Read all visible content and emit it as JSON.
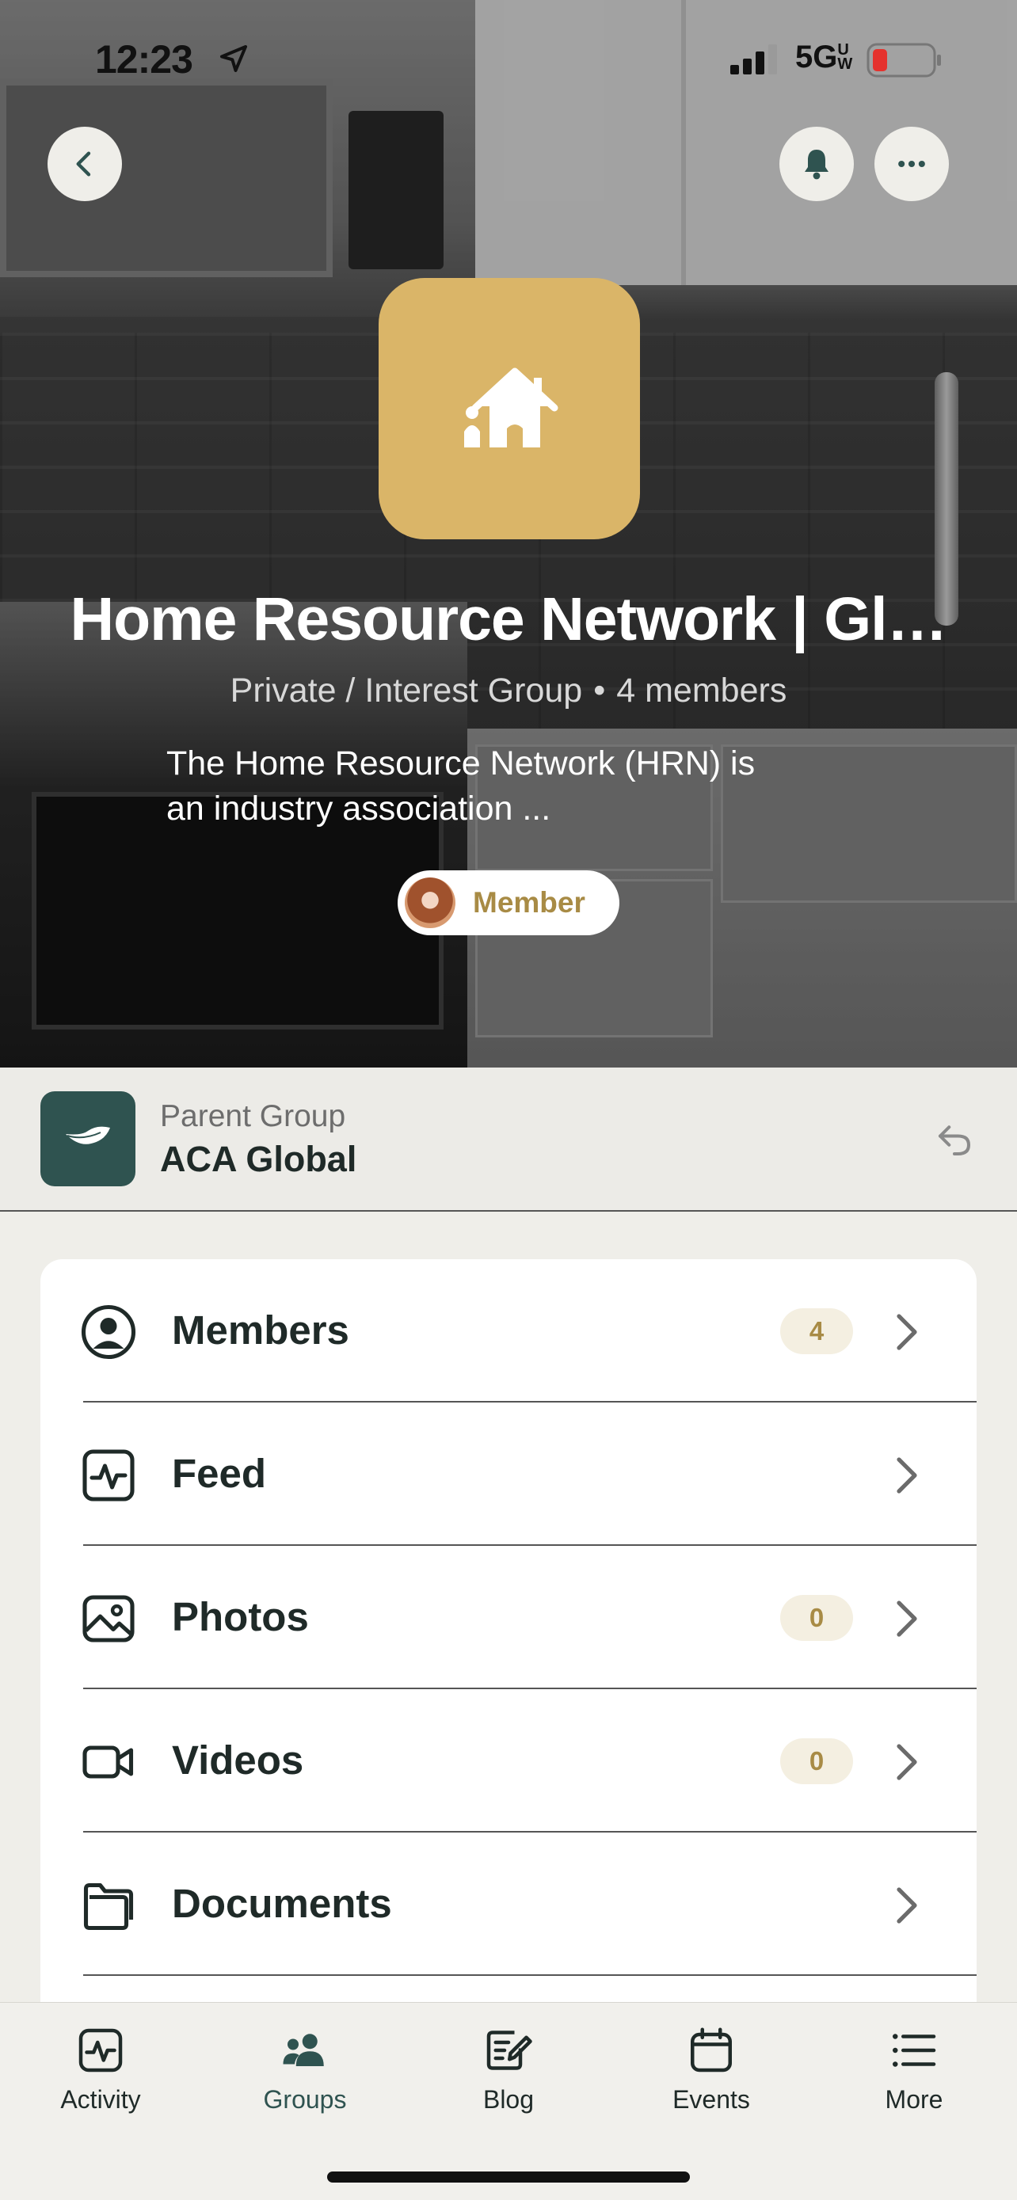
{
  "status_bar": {
    "time": "12:23",
    "network": "5G",
    "network_sub": "UW"
  },
  "header": {
    "back_icon": "chevron-left-icon",
    "bell_icon": "bell-icon",
    "more_icon": "ellipsis-icon"
  },
  "group": {
    "avatar_icon": "house-icon",
    "title": "Home Resource Network | Gl…",
    "privacy": "Private / Interest Group",
    "members_count": "4 members",
    "description_line1": "The Home Resource Network (HRN) is",
    "description_line2": "an industry association ...",
    "membership_label": "Member"
  },
  "parent_group": {
    "caption": "Parent Group",
    "name": "ACA Global"
  },
  "menu": {
    "items": [
      {
        "label": "Members",
        "badge": "4",
        "icon": "user-circle-icon"
      },
      {
        "label": "Feed",
        "badge": "",
        "icon": "activity-icon"
      },
      {
        "label": "Photos",
        "badge": "0",
        "icon": "photo-icon"
      },
      {
        "label": "Videos",
        "badge": "0",
        "icon": "video-icon"
      },
      {
        "label": "Documents",
        "badge": "",
        "icon": "folder-icon"
      }
    ]
  },
  "tabbar": {
    "tabs": [
      {
        "label": "Activity",
        "icon": "activity-icon"
      },
      {
        "label": "Groups",
        "icon": "groups-icon"
      },
      {
        "label": "Blog",
        "icon": "blog-icon"
      },
      {
        "label": "Events",
        "icon": "calendar-icon"
      },
      {
        "label": "More",
        "icon": "list-icon"
      }
    ],
    "active": "Groups"
  },
  "colors": {
    "accent": "#dab568",
    "badge_text": "#a88b45",
    "brand_dark": "#2f5350",
    "background": "#efeee9"
  }
}
